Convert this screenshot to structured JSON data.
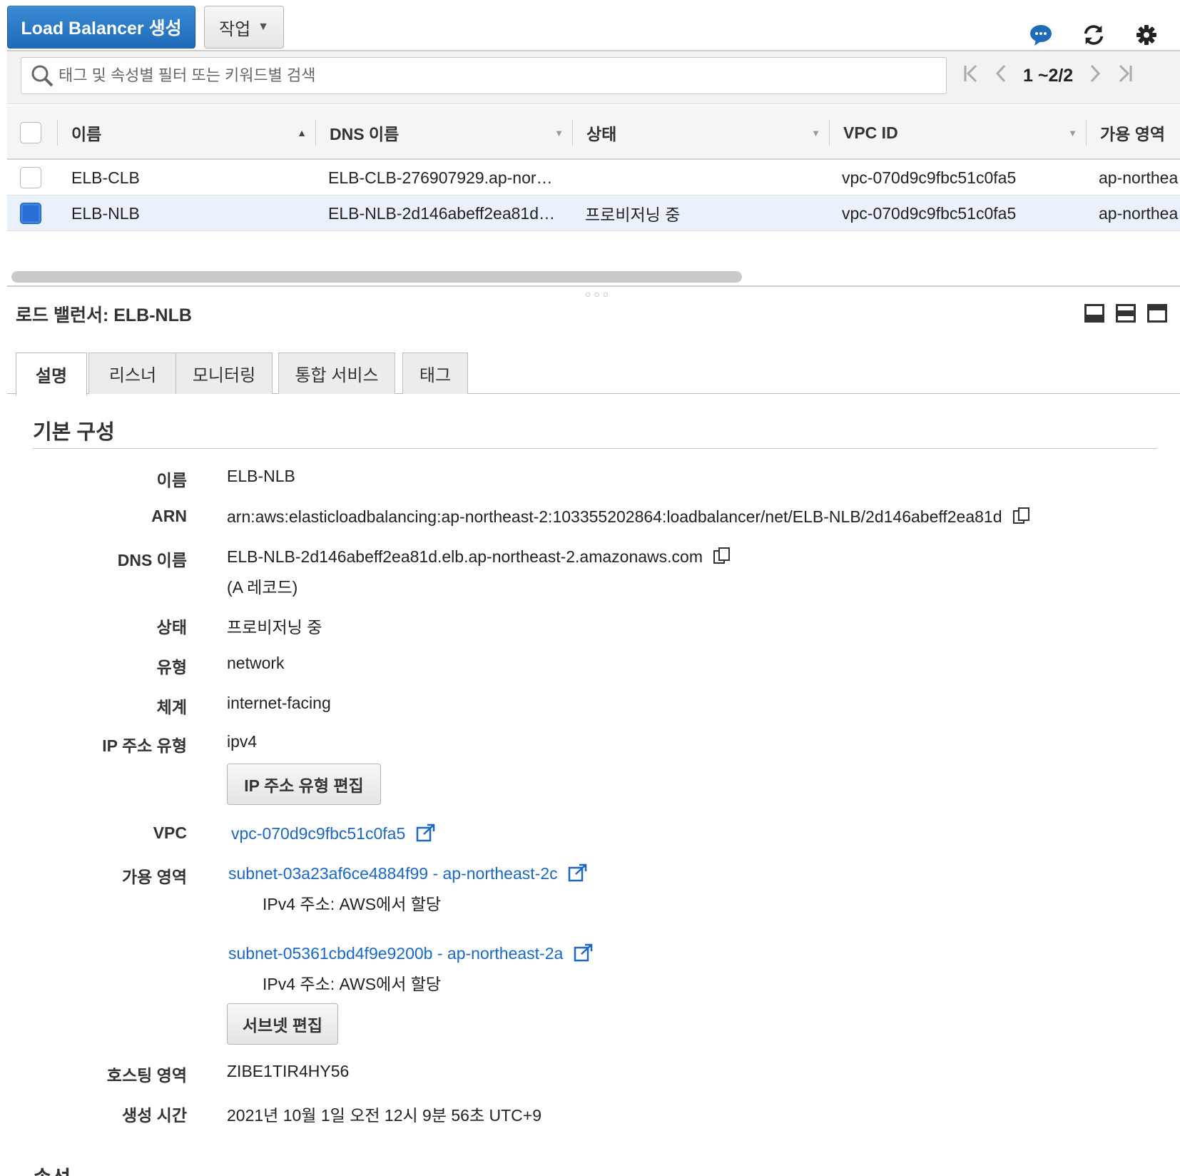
{
  "toolbar": {
    "create_label": "Load Balancer 생성",
    "actions_label": "작업",
    "icons": [
      "chat-icon",
      "refresh-icon",
      "gear-icon"
    ]
  },
  "search": {
    "placeholder": "태그 및 속성별 필터 또는 키워드별 검색",
    "pager_text": "1 ~2/2"
  },
  "table": {
    "columns": [
      "이름",
      "DNS 이름",
      "상태",
      "VPC ID",
      "가용 영역"
    ],
    "rows": [
      {
        "name": "ELB-CLB",
        "dns": "ELB-CLB-276907929.ap-nor…",
        "state": "",
        "vpc": "vpc-070d9c9fbc51c0fa5",
        "az": "ap-northea",
        "selected": false
      },
      {
        "name": "ELB-NLB",
        "dns": "ELB-NLB-2d146abeff2ea81d…",
        "state": "프로비저닝 중",
        "vpc": "vpc-070d9c9fbc51c0fa5",
        "az": "ap-northea",
        "selected": true
      }
    ]
  },
  "detail": {
    "title": "로드 밸런서: ELB-NLB",
    "tabs": [
      "설명",
      "리스너",
      "모니터링",
      "통합 서비스",
      "태그"
    ],
    "section_title": "기본 구성",
    "fields": {
      "name_label": "이름",
      "name": "ELB-NLB",
      "arn_label": "ARN",
      "arn": "arn:aws:elasticloadbalancing:ap-northeast-2:103355202864:loadbalancer/net/ELB-NLB/2d146abeff2ea81d",
      "dns_label": "DNS 이름",
      "dns": "ELB-NLB-2d146abeff2ea81d.elb.ap-northeast-2.amazonaws.com",
      "dns_record": "(A 레코드)",
      "state_label": "상태",
      "state": "프로비저닝 중",
      "type_label": "유형",
      "type": "network",
      "scheme_label": "체계",
      "scheme": "internet-facing",
      "ip_type_label": "IP 주소 유형",
      "ip_type": "ipv4",
      "edit_ip_button": "IP 주소 유형 편집",
      "vpc_label": "VPC",
      "vpc": "vpc-070d9c9fbc51c0fa5",
      "az_label": "가용 영역",
      "subnets": [
        {
          "link": "subnet-03a23af6ce4884f99 - ap-northeast-2c",
          "note": "IPv4 주소: AWS에서 할당"
        },
        {
          "link": "subnet-05361cbd4f9e9200b - ap-northeast-2a",
          "note": "IPv4 주소: AWS에서 할당"
        }
      ],
      "edit_subnet_button": "서브넷 편집",
      "hosted_zone_label": "호스팅 영역",
      "hosted_zone": "ZIBE1TIR4HY56",
      "created_label": "생성 시간",
      "created": "2021년 10월 1일 오전 12시 9분 56초 UTC+9"
    },
    "next_section_title": "속성"
  }
}
